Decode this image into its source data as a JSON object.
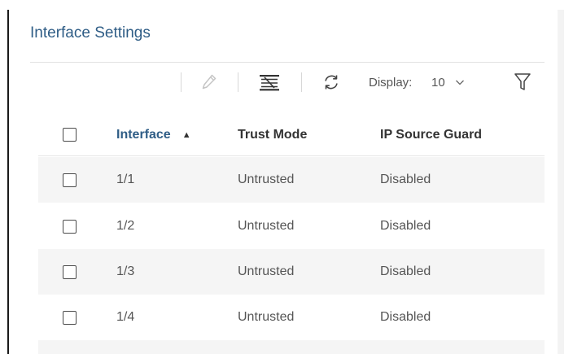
{
  "panel": {
    "title": "Interface Settings"
  },
  "toolbar": {
    "display_label": "Display:",
    "display_value": "10"
  },
  "table": {
    "columns": {
      "interface": "Interface",
      "sort_indicator": "▲",
      "trust_mode": "Trust Mode",
      "ip_source_guard": "IP Source Guard"
    },
    "rows": [
      {
        "interface": "1/1",
        "trust_mode": "Untrusted",
        "ip_source_guard": "Disabled"
      },
      {
        "interface": "1/2",
        "trust_mode": "Untrusted",
        "ip_source_guard": "Disabled"
      },
      {
        "interface": "1/3",
        "trust_mode": "Untrusted",
        "ip_source_guard": "Disabled"
      },
      {
        "interface": "1/4",
        "trust_mode": "Untrusted",
        "ip_source_guard": "Disabled"
      }
    ]
  },
  "colors": {
    "accent": "#2f5d86",
    "row_alt": "#f5f5f5",
    "text": "#555555"
  }
}
